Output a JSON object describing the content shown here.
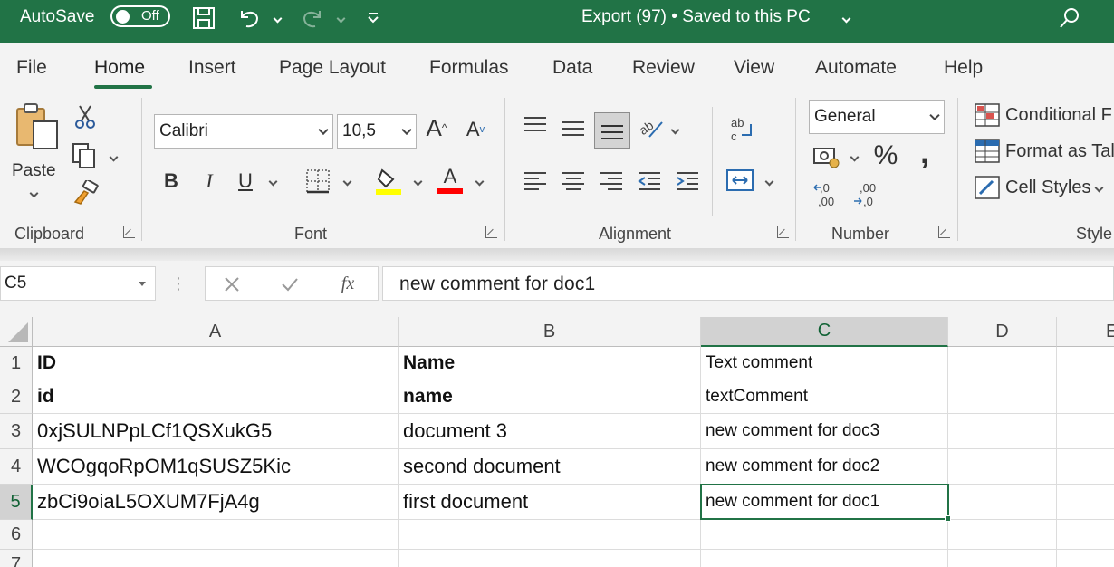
{
  "titlebar": {
    "autosave_label": "AutoSave",
    "autosave_state": "Off",
    "document_title": "Export (97) • Saved to this PC",
    "icons": [
      "save-icon",
      "undo-icon",
      "redo-icon",
      "customize-qat-icon",
      "search-icon"
    ]
  },
  "ribbon_tabs": [
    {
      "label": "File",
      "active": false
    },
    {
      "label": "Home",
      "active": true
    },
    {
      "label": "Insert",
      "active": false
    },
    {
      "label": "Page Layout",
      "active": false
    },
    {
      "label": "Formulas",
      "active": false
    },
    {
      "label": "Data",
      "active": false
    },
    {
      "label": "Review",
      "active": false
    },
    {
      "label": "View",
      "active": false
    },
    {
      "label": "Automate",
      "active": false
    },
    {
      "label": "Help",
      "active": false
    }
  ],
  "ribbon": {
    "clipboard": {
      "label": "Clipboard",
      "paste": "Paste"
    },
    "font": {
      "label": "Font",
      "font_name": "Calibri",
      "font_size": "10,5",
      "bold": "B",
      "italic": "I",
      "underline": "U"
    },
    "alignment": {
      "label": "Alignment"
    },
    "number": {
      "label": "Number",
      "format": "General",
      "percent": "%",
      "comma": ","
    },
    "styles": {
      "label": "Style",
      "conditional": "Conditional F",
      "format_table": "Format as Tal",
      "cell_styles": "Cell Styles"
    }
  },
  "colors": {
    "accent": "#217346",
    "highlight_yellow": "#ffff00",
    "font_red": "#ff0000"
  },
  "formula_bar": {
    "name_box": "C5",
    "fx": "fx",
    "formula": "new comment for doc1"
  },
  "sheet": {
    "columns": [
      "A",
      "B",
      "C",
      "D",
      "E"
    ],
    "selected_column": "C",
    "selected_row": "5",
    "rows": [
      {
        "num": "1",
        "cells": [
          "ID",
          "Name",
          "Text comment"
        ]
      },
      {
        "num": "2",
        "cells": [
          "id",
          "name",
          "textComment"
        ]
      },
      {
        "num": "3",
        "cells": [
          "0xjSULNPpLCf1QSXukG5",
          "document 3",
          "new comment for doc3"
        ]
      },
      {
        "num": "4",
        "cells": [
          "WCOgqoRpOM1qSUSZ5Kic",
          "second document",
          "new comment for doc2"
        ]
      },
      {
        "num": "5",
        "cells": [
          "zbCi9oiaL5OXUM7FjA4g",
          "first document",
          "new comment for doc1"
        ]
      },
      {
        "num": "6",
        "cells": [
          "",
          "",
          ""
        ]
      },
      {
        "num": "7",
        "cells": [
          "",
          "",
          ""
        ]
      }
    ]
  }
}
